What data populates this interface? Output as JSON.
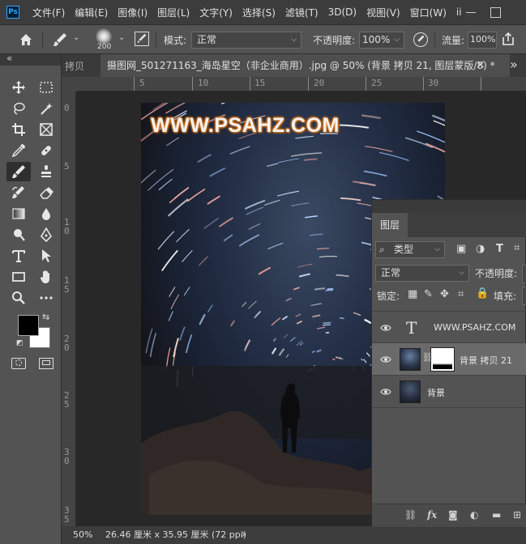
{
  "app": {
    "logo": "Ps"
  },
  "menu": [
    "文件(F)",
    "编辑(E)",
    "图像(I)",
    "图层(L)",
    "文字(Y)",
    "选择(S)",
    "滤镜(T)",
    "3D(D)",
    "视图(V)",
    "窗口(W)",
    "ii"
  ],
  "options": {
    "brush_size": "200",
    "mode_label": "模式:",
    "mode_value": "正常",
    "opacity_label": "不透明度:",
    "opacity_value": "100%",
    "flow_label": "流量:",
    "flow_value": "100%"
  },
  "tabs": {
    "prev_tab_fragment": "拷贝",
    "document_tab": "摄图网_501271163_海岛星空（非企业商用）.jpg @ 50% (背景 拷贝 21, 图层蒙版/8) *",
    "close_glyph": "×",
    "collapse_glyph": "«",
    "more_glyph": "»"
  },
  "ruler": {
    "h_labels": [
      "0",
      "5",
      "10",
      "15",
      "20",
      "25",
      "30"
    ],
    "v_labels": [
      "0",
      "5",
      "1\n0",
      "1\n5",
      "2\n0",
      "2\n5",
      "3\n0",
      "3\n5"
    ]
  },
  "image": {
    "watermark": "WWW.PSAHZ.COM"
  },
  "status": {
    "zoom": "50%",
    "doc_info": "26.46 厘米 x 35.95 厘米 (72 ppi)",
    "arrow": "›"
  },
  "layers_panel": {
    "tab_label": "图层",
    "filter_label": "类型",
    "blend_mode": "正常",
    "opacity_label": "不透明度:",
    "lock_label": "锁定:",
    "fill_label": "填充:",
    "layers": [
      {
        "name": "WWW.PSAHZ.COM",
        "kind": "text",
        "visible": true
      },
      {
        "name": "背景 拷贝 21",
        "kind": "image-with-mask",
        "visible": true,
        "selected": true
      },
      {
        "name": "背景",
        "kind": "image",
        "visible": true
      }
    ]
  },
  "colors": {
    "accent": "#31a8ff",
    "watermark": "#f0f0f0",
    "watermark_glow": "#e07a1a",
    "selected_row": "#6a6a6a"
  }
}
